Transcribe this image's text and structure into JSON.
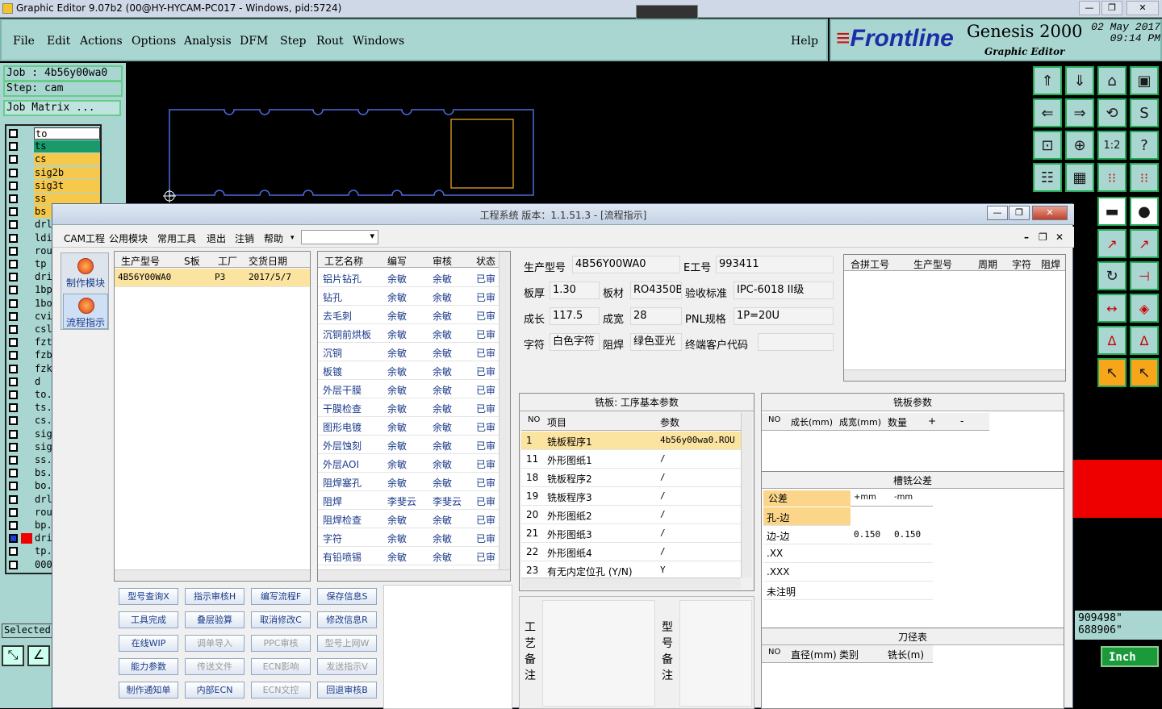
{
  "genesis": {
    "title": "Graphic Editor 9.07b2 (00@HY-HYCAM-PC017 - Windows, pid:5724)",
    "menu": [
      "File",
      "Edit",
      "Actions",
      "Options",
      "Analysis",
      "DFM",
      "Step",
      "Rout",
      "Windows"
    ],
    "help": "Help",
    "logo": {
      "brand_a": "≡",
      "brand_b": "Frontline",
      "product": "Genesis 2000",
      "sub": "Graphic Editor",
      "date": "02 May 2017",
      "time": "09:14 PM"
    },
    "job": "Job : 4b56y00wa0",
    "step": "Step: cam",
    "job_matrix": "Job Matrix ...",
    "layers": [
      "to",
      "ts",
      "cs",
      "sig2b",
      "sig3t",
      "ss",
      "bs",
      "drl",
      "ldi",
      "rou",
      "tp",
      "dri",
      "1bp",
      "1bo",
      "cvi",
      "csl",
      "fzt",
      "fzb",
      "fzk",
      "d",
      "to.",
      "ts.",
      "cs.",
      "sig",
      "sig",
      "ss.",
      "bs.",
      "bo.",
      "drl",
      "rou",
      "bp.",
      "dri",
      "tp.",
      "000"
    ],
    "selected": "Selected",
    "coords": [
      "909498\"",
      "688906\""
    ],
    "units": "Inch",
    "colors": {
      "teal": "#a9d6d1",
      "layer_active": "#f6c84b",
      "layer_sel": "#1a9a6a"
    }
  },
  "dialog": {
    "title": "工程系统   版本：1.1.51.3 - [流程指示]",
    "menu": [
      "CAM工程",
      "公用模块",
      "常用工具",
      "退出",
      "注销",
      "帮助"
    ],
    "side": [
      "制作模块",
      "流程指示"
    ],
    "orders": {
      "headers": [
        "生产型号",
        "S板",
        "工厂",
        "交货日期"
      ],
      "rows": [
        [
          "4B56Y00WA0",
          "",
          "P3",
          "2017/5/7"
        ]
      ]
    },
    "process": {
      "headers": [
        "工艺名称",
        "编写",
        "审核",
        "状态"
      ],
      "rows": [
        [
          "铝片钻孔",
          "余敏",
          "余敏",
          "已审"
        ],
        [
          "钻孔",
          "余敏",
          "余敏",
          "已审"
        ],
        [
          "去毛刺",
          "余敏",
          "余敏",
          "已审"
        ],
        [
          "沉铜前烘板",
          "余敏",
          "余敏",
          "已审"
        ],
        [
          "沉铜",
          "余敏",
          "余敏",
          "已审"
        ],
        [
          "板镀",
          "余敏",
          "余敏",
          "已审"
        ],
        [
          "外层干膜",
          "余敏",
          "余敏",
          "已审"
        ],
        [
          "干膜检查",
          "余敏",
          "余敏",
          "已审"
        ],
        [
          "图形电镀",
          "余敏",
          "余敏",
          "已审"
        ],
        [
          "外层蚀刻",
          "余敏",
          "余敏",
          "已审"
        ],
        [
          "外层AOI",
          "余敏",
          "余敏",
          "已审"
        ],
        [
          "阻焊塞孔",
          "余敏",
          "余敏",
          "已审"
        ],
        [
          "阻焊",
          "李斐云",
          "李斐云",
          "已审"
        ],
        [
          "阻焊检查",
          "余敏",
          "余敏",
          "已审"
        ],
        [
          "字符",
          "余敏",
          "余敏",
          "已审"
        ],
        [
          "有铅喷锡",
          "余敏",
          "余敏",
          "已审"
        ]
      ]
    },
    "buttons": [
      [
        "型号查询X",
        "指示审核H",
        "编写流程F",
        "保存信息S"
      ],
      [
        "工具完成",
        "叠层验算",
        "取消修改C",
        "修改信息R"
      ],
      [
        "在线WIP",
        "调单导入",
        "PPC审核",
        "型号上网W"
      ],
      [
        "能力参数",
        "传送文件",
        "ECN影响",
        "发送指示V"
      ],
      [
        "制作通知单",
        "内部ECN",
        "ECN文控",
        "回退审核B"
      ]
    ],
    "disabled": [
      "调单导入",
      "传送文件",
      "PPC审核",
      "ECN影响",
      "ECN文控",
      "型号上网W",
      "发送指示V"
    ],
    "info": {
      "model_l": "生产型号",
      "model": "4B56Y00WA0",
      "eno_l": "E工号",
      "eno": "993411",
      "thick_l": "板厚",
      "thick": "1.30",
      "mat_l": "板材",
      "mat": "RO4350B",
      "std_l": "验收标准",
      "std": "IPC-6018 II级",
      "len_l": "成长",
      "len": "117.5",
      "wid_l": "成宽",
      "wid": "28",
      "pnl_l": "PNL规格",
      "pnl": "1P=20U",
      "char_l": "字符",
      "char": "白色字符",
      "mask_l": "阻焊",
      "mask": "绿色亚光",
      "cust_l": "终端客户代码",
      "cust": ""
    },
    "combine": {
      "headers": [
        "合拼工号",
        "生产型号",
        "周期",
        "字符",
        "阻焊"
      ]
    },
    "mill": {
      "title": "铣板: 工序基本参数",
      "headers": [
        "NO",
        "项目",
        "参数"
      ],
      "rows": [
        [
          "1",
          "铣板程序1",
          "4b56y00wa0.ROU"
        ],
        [
          "11",
          "外形图纸1",
          "/"
        ],
        [
          "18",
          "铣板程序2",
          "/"
        ],
        [
          "19",
          "铣板程序3",
          "/"
        ],
        [
          "20",
          "外形图纸2",
          "/"
        ],
        [
          "21",
          "外形图纸3",
          "/"
        ],
        [
          "22",
          "外形图纸4",
          "/"
        ],
        [
          "23",
          "有无内定位孔 (Y/N)",
          "Y"
        ]
      ]
    },
    "millparams": {
      "title": "铣板参数",
      "headers": [
        "NO",
        "成长(mm)",
        "成宽(mm)",
        "数量",
        "+",
        "-"
      ]
    },
    "tol": {
      "title": "槽铣公差",
      "headers": [
        "公差",
        "+mm",
        "-mm"
      ],
      "rows": [
        [
          "孔-边",
          "",
          ""
        ],
        [
          "边-边",
          "0.150",
          "0.150"
        ],
        [
          ".XX",
          "",
          ""
        ],
        [
          ".XXX",
          "",
          ""
        ],
        [
          "未注明",
          "",
          ""
        ]
      ]
    },
    "tools": {
      "title": "刀径表",
      "headers": [
        "NO",
        "直径(mm)",
        "类别",
        "铣长(m)"
      ]
    },
    "notes": {
      "proc": [
        "工",
        "艺",
        "备",
        "注"
      ],
      "model": [
        "型",
        "号",
        "备",
        "注"
      ]
    }
  }
}
